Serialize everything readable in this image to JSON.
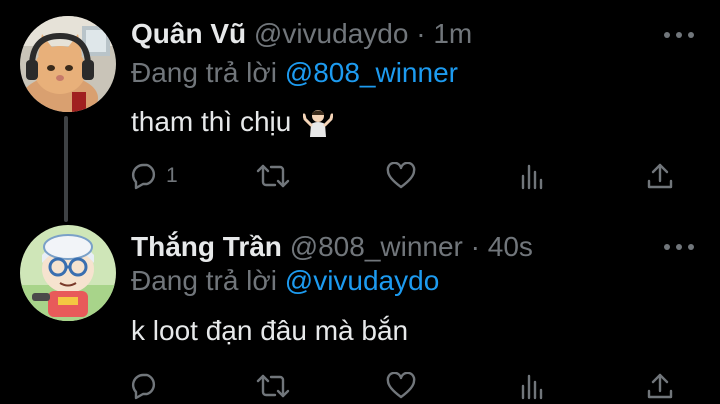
{
  "colors": {
    "background": "#000000",
    "primary_text": "#e7e9ea",
    "secondary_text": "#71767b",
    "link": "#1d9bf0",
    "thread_line": "#3e4144"
  },
  "tweets": [
    {
      "display_name": "Quân Vũ",
      "handle": "@vivudaydo",
      "separator": "·",
      "time": "1m",
      "reply_prefix": "Đang trả lời",
      "reply_to": "@808_winner",
      "text": "tham thì chịu",
      "emoji": "person-shrugging-emoji",
      "avatar": "cat-with-headphones-avatar",
      "actions": {
        "reply_count": "1",
        "retweet_count": "",
        "like_count": ""
      }
    },
    {
      "display_name": "Thắng Trần",
      "handle": "@808_winner",
      "separator": "·",
      "time": "40s",
      "reply_prefix": "Đang trả lời",
      "reply_to": "@vivudaydo",
      "text": "k loot đạn đâu mà bắn",
      "avatar": "cartoon-boy-avatar",
      "actions": {
        "reply_count": "",
        "retweet_count": "",
        "like_count": ""
      }
    }
  ],
  "icons": [
    "reply-icon",
    "retweet-icon",
    "like-icon",
    "stats-icon",
    "share-icon",
    "more-icon"
  ]
}
